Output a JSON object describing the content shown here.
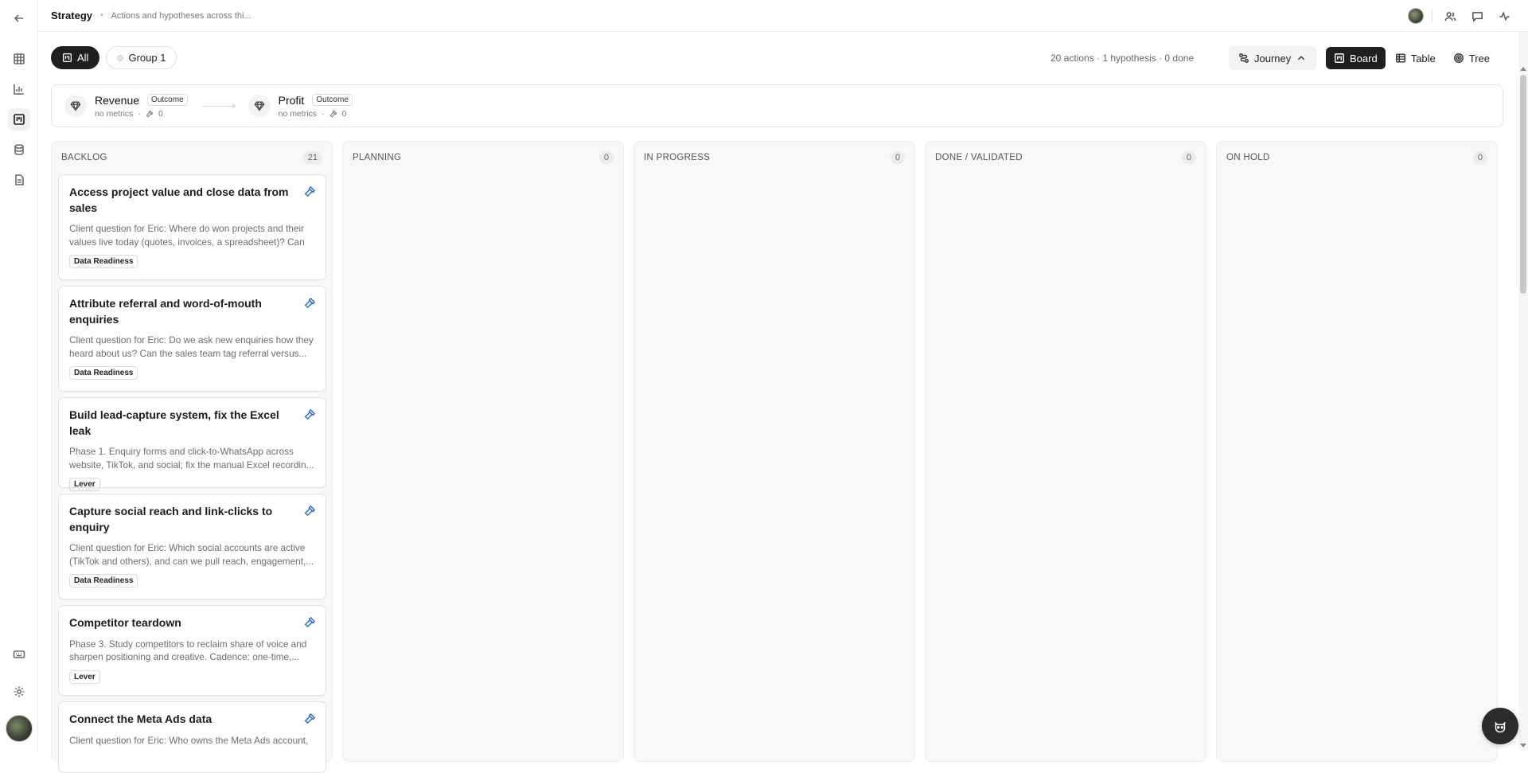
{
  "header": {
    "title": "Strategy",
    "subtitle": "Actions and hypotheses across thi..."
  },
  "rail": {
    "items": [
      "back-icon",
      "grid-icon",
      "chart-icon",
      "board-icon",
      "database-icon",
      "document-icon",
      "keyboard-icon",
      "settings-icon"
    ],
    "active": "board-icon"
  },
  "filters": {
    "all_label": "All",
    "group_label": "Group 1"
  },
  "toolbar": {
    "stats": "20 actions · 1 hypothesis · 0 done",
    "journey_label": "Journey",
    "views": [
      "Board",
      "Table",
      "Tree"
    ],
    "active_view": "Board"
  },
  "outcomes": [
    {
      "name": "Revenue",
      "badge": "Outcome",
      "metrics": "no metrics",
      "count": "0"
    },
    {
      "name": "Profit",
      "badge": "Outcome",
      "metrics": "no metrics",
      "count": "0"
    }
  ],
  "columns": [
    {
      "title": "BACKLOG",
      "count": "21"
    },
    {
      "title": "PLANNING",
      "count": "0"
    },
    {
      "title": "IN PROGRESS",
      "count": "0"
    },
    {
      "title": "DONE / VALIDATED",
      "count": "0"
    },
    {
      "title": "ON HOLD",
      "count": "0"
    }
  ],
  "cards": [
    {
      "title": "Access project value and close data from sales",
      "desc": "Client question for Eric: Where do won projects and their values live today (quotes, invoices, a spreadsheet)? Can ...",
      "tag": "Data Readiness"
    },
    {
      "title": "Attribute referral and word-of-mouth enquiries",
      "desc": "Client question for Eric: Do we ask new enquiries how they heard about us? Can the sales team tag referral versus...",
      "tag": "Data Readiness"
    },
    {
      "title": "Build lead-capture system, fix the Excel leak",
      "desc": "Phase 1. Enquiry forms and click-to-WhatsApp across website, TikTok, and social; fix the manual Excel recordin...",
      "tag": "Lever"
    },
    {
      "title": "Capture social reach and link-clicks to enquiry",
      "desc": "Client question for Eric: Which social accounts are active (TikTok and others), and can we pull reach, engagement,...",
      "tag": "Data Readiness"
    },
    {
      "title": "Competitor teardown",
      "desc": "Phase 3. Study competitors to reclaim share of voice and sharpen positioning and creative. Cadence: one-time,...",
      "tag": "Lever"
    },
    {
      "title": "Connect the Meta Ads data",
      "desc": "Client question for Eric: Who owns the Meta Ads account,",
      "tag": ""
    }
  ]
}
